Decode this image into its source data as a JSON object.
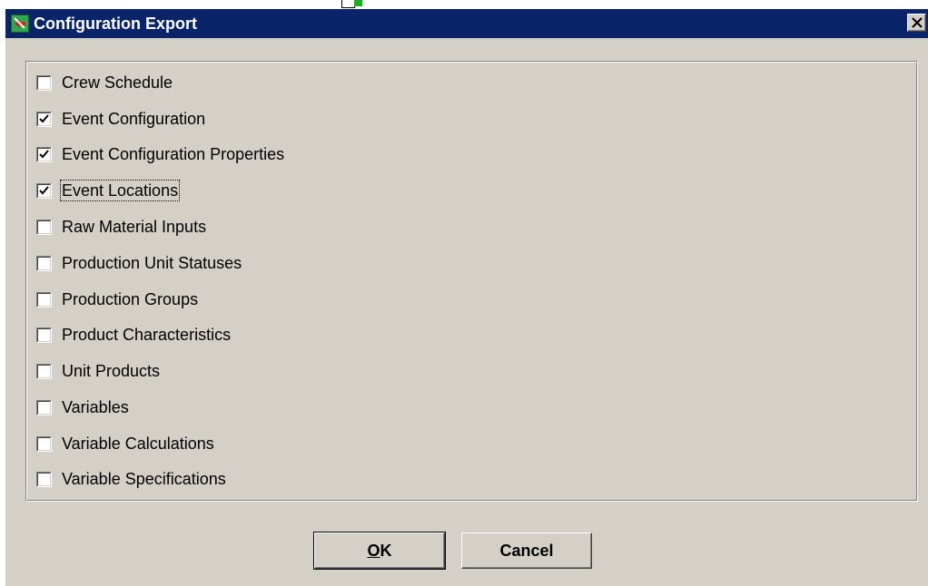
{
  "dialog": {
    "title": "Configuration Export",
    "close_label": "Close"
  },
  "options": [
    {
      "label": "Crew Schedule",
      "checked": false,
      "focused": false
    },
    {
      "label": "Event Configuration",
      "checked": true,
      "focused": false
    },
    {
      "label": "Event Configuration Properties",
      "checked": true,
      "focused": false
    },
    {
      "label": "Event Locations",
      "checked": true,
      "focused": true
    },
    {
      "label": "Raw Material Inputs",
      "checked": false,
      "focused": false
    },
    {
      "label": "Production Unit Statuses",
      "checked": false,
      "focused": false
    },
    {
      "label": "Production Groups",
      "checked": false,
      "focused": false
    },
    {
      "label": "Product Characteristics",
      "checked": false,
      "focused": false
    },
    {
      "label": "Unit Products",
      "checked": false,
      "focused": false
    },
    {
      "label": "Variables",
      "checked": false,
      "focused": false
    },
    {
      "label": "Variable Calculations",
      "checked": false,
      "focused": false
    },
    {
      "label": "Variable Specifications",
      "checked": false,
      "focused": false
    }
  ],
  "buttons": {
    "ok_mnemonic": "O",
    "ok_rest": "K",
    "cancel_label": "Cancel"
  },
  "icons": {
    "app": "export-app-icon",
    "close": "close-icon",
    "check": "checkmark-icon"
  },
  "colors": {
    "titlebar": "#0a246a",
    "dialog_face": "#d4d0c8",
    "app_icon": "#2fa84f"
  }
}
